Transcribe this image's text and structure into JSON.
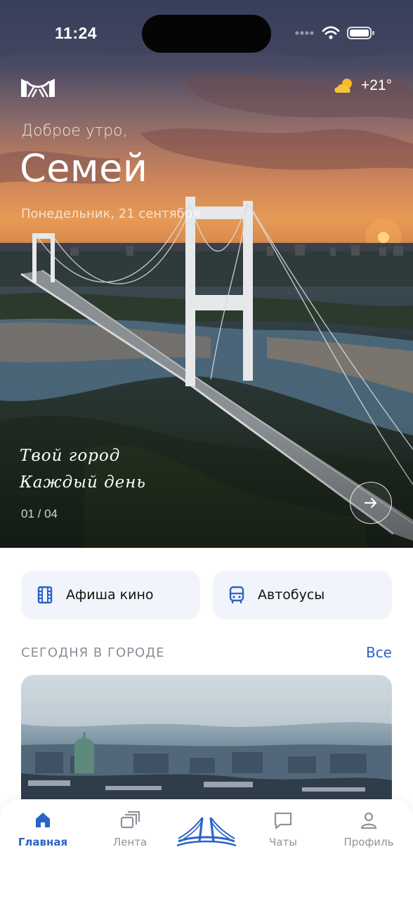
{
  "status_bar": {
    "time": "11:24"
  },
  "header": {
    "weather_temp": "+21°",
    "greeting": "Доброе утро,",
    "city": "Семей",
    "date": "Понедельник, 21 сентября"
  },
  "hero": {
    "slogan_line1": "Твой город",
    "slogan_line2": "Каждый день",
    "slide_counter": "01 / 04"
  },
  "quick_actions": [
    {
      "label": "Афиша кино",
      "icon": "film-icon"
    },
    {
      "label": "Автобусы",
      "icon": "bus-icon"
    }
  ],
  "today_section": {
    "title": "СЕГОДНЯ В ГОРОДЕ",
    "see_all": "Все"
  },
  "tab_bar": {
    "items": [
      {
        "label": "Главная",
        "icon": "home-icon",
        "active": true
      },
      {
        "label": "Лента",
        "icon": "feed-icon",
        "active": false
      },
      {
        "label": "",
        "icon": "bridge-logo-icon",
        "active": false
      },
      {
        "label": "Чаты",
        "icon": "chat-icon",
        "active": false
      },
      {
        "label": "Профиль",
        "icon": "profile-icon",
        "active": false
      }
    ]
  },
  "colors": {
    "accent": "#2a63c8",
    "card_bg": "#f1f4fa",
    "muted_text": "#8a8f99"
  }
}
